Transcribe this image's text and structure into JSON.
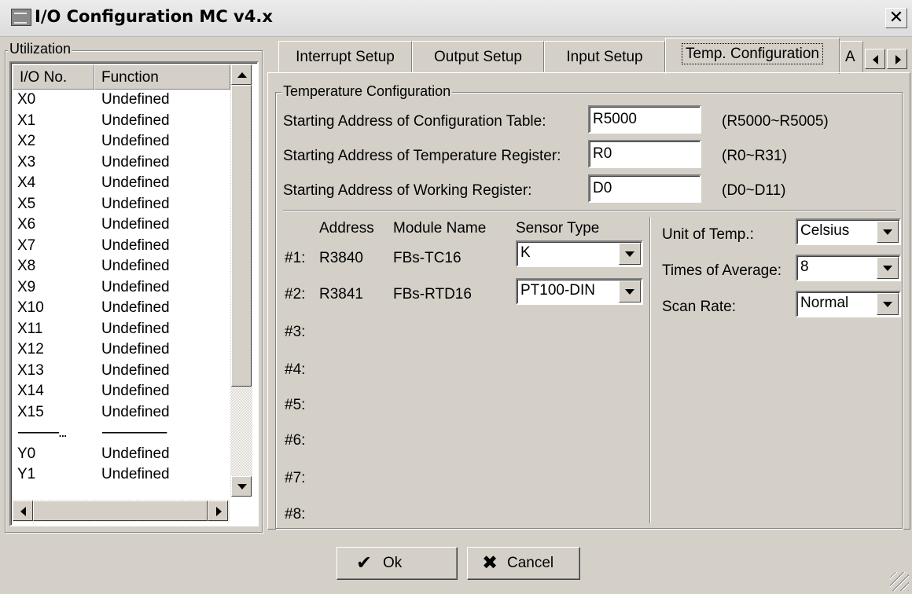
{
  "window": {
    "title": "I/O Configuration MC v4.x",
    "close_label": "✕"
  },
  "utilization": {
    "legend": "Utilization",
    "columns": [
      "I/O No.",
      "Function"
    ],
    "rows": [
      [
        "X0",
        "Undefined"
      ],
      [
        "X1",
        "Undefined"
      ],
      [
        "X2",
        "Undefined"
      ],
      [
        "X3",
        "Undefined"
      ],
      [
        "X4",
        "Undefined"
      ],
      [
        "X5",
        "Undefined"
      ],
      [
        "X6",
        "Undefined"
      ],
      [
        "X7",
        "Undefined"
      ],
      [
        "X8",
        "Undefined"
      ],
      [
        "X9",
        "Undefined"
      ],
      [
        "X10",
        "Undefined"
      ],
      [
        "X11",
        "Undefined"
      ],
      [
        "X12",
        "Undefined"
      ],
      [
        "X13",
        "Undefined"
      ],
      [
        "X14",
        "Undefined"
      ],
      [
        "X15",
        "Undefined"
      ],
      [
        "------------...",
        "-------------------"
      ],
      [
        "Y0",
        "Undefined"
      ],
      [
        "Y1",
        "Undefined"
      ]
    ]
  },
  "tabs": [
    {
      "label": "Interrupt Setup",
      "active": false
    },
    {
      "label": "Output Setup",
      "active": false
    },
    {
      "label": "Input Setup",
      "active": false
    },
    {
      "label": "Temp. Configuration",
      "active": true
    },
    {
      "label": "A",
      "active": false
    }
  ],
  "temp_config": {
    "legend": "Temperature Configuration",
    "fields": [
      {
        "label": "Starting Address of Configuration Table:",
        "value": "R5000",
        "range": "(R5000~R5005)"
      },
      {
        "label": "Starting Address of Temperature Register:",
        "value": "R0",
        "range": "(R0~R31)"
      },
      {
        "label": "Starting Address of Working Register:",
        "value": "D0",
        "range": "(D0~D11)"
      }
    ],
    "module_headers": {
      "address": "Address",
      "module_name": "Module Name",
      "sensor_type": "Sensor Type"
    },
    "modules": [
      {
        "slot": "#1:",
        "address": "R3840",
        "module_name": "FBs-TC16",
        "sensor_type": "K"
      },
      {
        "slot": "#2:",
        "address": "R3841",
        "module_name": "FBs-RTD16",
        "sensor_type": "PT100-DIN"
      },
      {
        "slot": "#3:"
      },
      {
        "slot": "#4:"
      },
      {
        "slot": "#5:"
      },
      {
        "slot": "#6:"
      },
      {
        "slot": "#7:"
      },
      {
        "slot": "#8:"
      }
    ],
    "settings": [
      {
        "label": "Unit of Temp.:",
        "value": "Celsius"
      },
      {
        "label": "Times of Average:",
        "value": "8"
      },
      {
        "label": "Scan Rate:",
        "value": "Normal"
      }
    ]
  },
  "buttons": {
    "ok": {
      "label": "Ok",
      "icon": "check-icon"
    },
    "cancel": {
      "label": "Cancel",
      "icon": "x-icon"
    }
  }
}
